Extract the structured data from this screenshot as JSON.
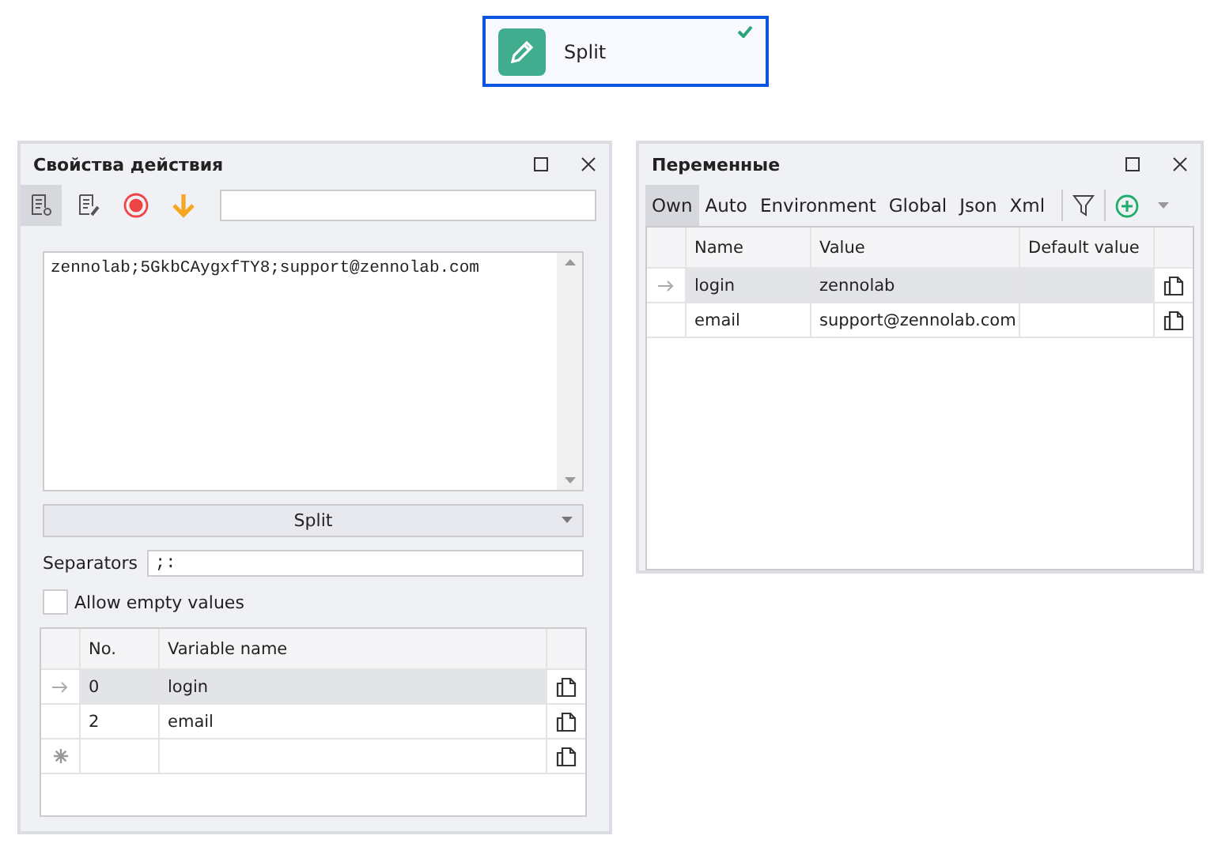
{
  "node": {
    "title": "Split",
    "done": true
  },
  "action_panel": {
    "title": "Свойства действия",
    "toolbar": [
      {
        "kind": "settings",
        "selected": true
      },
      {
        "kind": "edit",
        "selected": false
      },
      {
        "kind": "record",
        "selected": false
      },
      {
        "kind": "down",
        "selected": false
      }
    ],
    "text_value": "zennolab;5GkbCAygxfTY8;support@zennolab.com",
    "mode": "Split",
    "separators_label": "Separators",
    "separators_value": ";:",
    "allow_empty": {
      "label": "Allow empty values",
      "checked": false
    },
    "table": {
      "columns": [
        "No.",
        "Variable name"
      ],
      "rows": [
        {
          "no": "0",
          "name": "login",
          "selected": true
        },
        {
          "no": "2",
          "name": "email",
          "selected": false
        }
      ]
    }
  },
  "vars_panel": {
    "title": "Переменные",
    "tabs": [
      {
        "label": "Own",
        "selected": true
      },
      {
        "label": "Auto",
        "selected": false
      },
      {
        "label": "Environment",
        "selected": false
      },
      {
        "label": "Global",
        "selected": false
      },
      {
        "label": "Json",
        "selected": false
      },
      {
        "label": "Xml",
        "selected": false
      }
    ],
    "table": {
      "columns": [
        "Name",
        "Value",
        "Default value"
      ],
      "rows": [
        {
          "name": "login",
          "value": "zennolab",
          "default": "",
          "selected": true
        },
        {
          "name": "email",
          "value": "support@zennolab.com",
          "default": "",
          "selected": false
        }
      ]
    }
  }
}
